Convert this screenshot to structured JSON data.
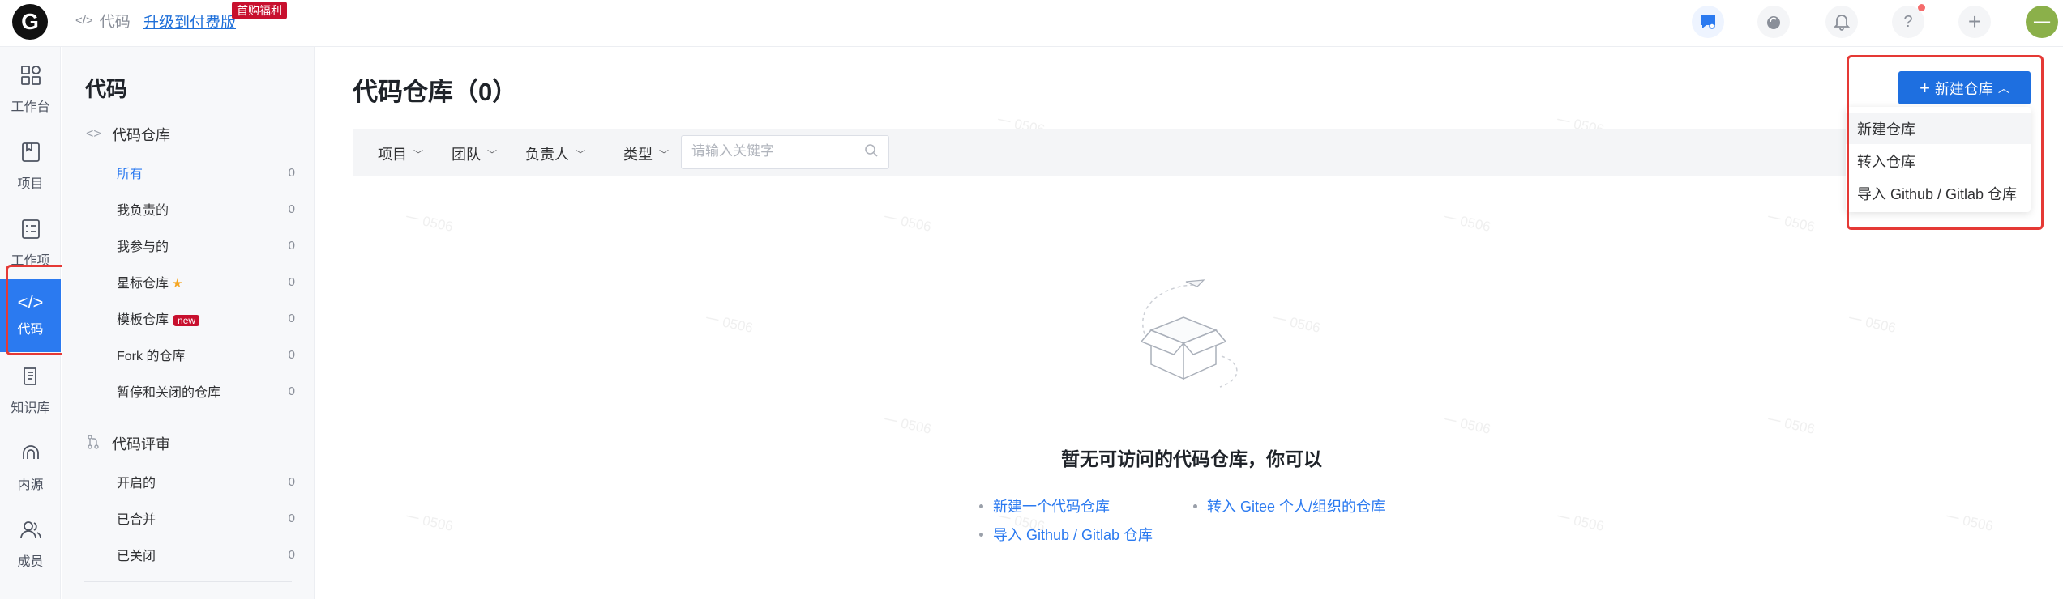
{
  "topbar": {
    "logo_letter": "G",
    "breadcrumb_icon": "code-icon",
    "breadcrumb": "代码",
    "upgrade_link": "升级到付费版",
    "promo_badge": "首购福利",
    "icons": [
      "chat-icon",
      "drop-icon",
      "bell-icon",
      "help-icon",
      "plus-icon"
    ],
    "avatar_text": "一"
  },
  "rail": {
    "items": [
      {
        "label": "工作台",
        "icon": "dashboard-icon"
      },
      {
        "label": "项目",
        "icon": "project-icon"
      },
      {
        "label": "工作项",
        "icon": "task-icon"
      },
      {
        "label": "代码",
        "icon": "code-icon",
        "active": true
      },
      {
        "label": "知识库",
        "icon": "book-icon"
      },
      {
        "label": "内源",
        "icon": "innersource-icon"
      },
      {
        "label": "成员",
        "icon": "members-icon"
      }
    ]
  },
  "sidebar": {
    "title": "代码",
    "repo_group": "代码仓库",
    "repo_items": [
      {
        "label": "所有",
        "count": "0"
      },
      {
        "label": "我负责的",
        "count": "0"
      },
      {
        "label": "我参与的",
        "count": "0"
      },
      {
        "label": "星标仓库",
        "count": "0"
      },
      {
        "label": "模板仓库",
        "count": "0",
        "badge": "new"
      },
      {
        "label": "Fork 的仓库",
        "count": "0"
      },
      {
        "label": "暂停和关闭的仓库",
        "count": "0"
      }
    ],
    "review_group": "代码评审",
    "review_items": [
      {
        "label": "开启的",
        "count": "0"
      },
      {
        "label": "已合并",
        "count": "0"
      },
      {
        "label": "已关闭",
        "count": "0"
      }
    ]
  },
  "main": {
    "title": "代码仓库（0）",
    "filters": [
      "项目",
      "团队",
      "负责人",
      "类型"
    ],
    "search_placeholder": "请输入关键字",
    "new_button": "新建仓库",
    "dropdown": [
      "新建仓库",
      "转入仓库",
      "导入 Github / Gitlab 仓库"
    ],
    "empty": {
      "title": "暂无可访问的代码仓库，你可以",
      "links": [
        "新建一个代码仓库",
        "转入 Gitee 个人/组织的仓库",
        "导入 Github / Gitlab 仓库"
      ]
    }
  },
  "watermark": "一 0506",
  "colors": {
    "accent": "#2b7af0",
    "highlight": "#e53935",
    "promo": "#c8102e"
  }
}
